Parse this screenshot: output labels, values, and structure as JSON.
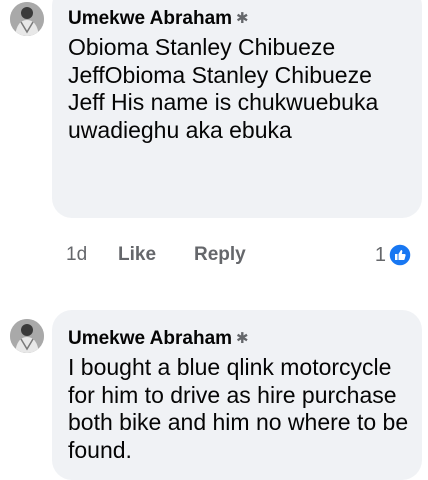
{
  "comments": [
    {
      "author": "Umekwe Abraham",
      "badge_icon": "top-fan-badge-icon",
      "text": "Obioma Stanley Chibueze JeffObioma Stanley Chibueze Jeff His name is chukwuebuka uwadieghu aka ebuka",
      "time": "1d",
      "like_label": "Like",
      "reply_label": "Reply",
      "reaction_count": "1",
      "reaction_icon": "like-reaction-icon"
    },
    {
      "author": "Umekwe Abraham",
      "badge_icon": "top-fan-badge-icon",
      "text": "I bought a blue qlink motorcycle for him to drive as hire purchase both bike and him no where to be found."
    }
  ],
  "colors": {
    "bubble": "#f0f2f5",
    "text": "#050505",
    "secondary": "#65676b",
    "like_blue": "#1877f2"
  }
}
